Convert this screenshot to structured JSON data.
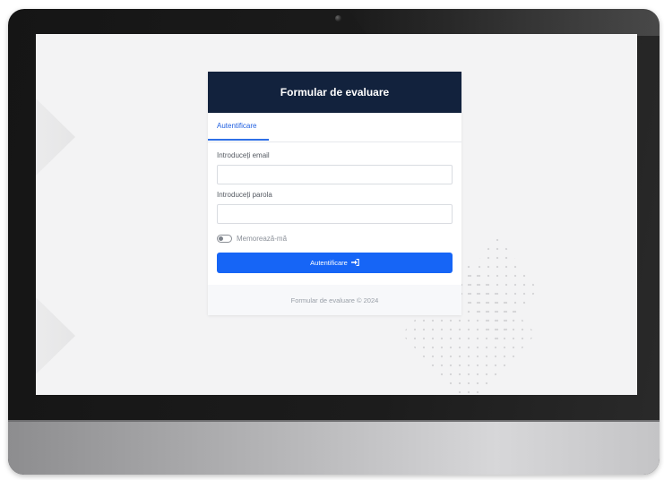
{
  "card": {
    "title": "Formular de evaluare"
  },
  "tabs": [
    {
      "label": "Autentificare",
      "active": true
    }
  ],
  "form": {
    "email_label": "Introduceți email",
    "email_value": "",
    "email_placeholder": "",
    "password_label": "Introduceți parola",
    "password_value": "",
    "password_placeholder": "",
    "remember_label": "Memorează-mă",
    "remember_checked": false,
    "submit_label": "Autentificare",
    "submit_icon": "sign-in-icon"
  },
  "footer": {
    "text": "Formular de evaluare © 2024"
  },
  "colors": {
    "header_bg": "#12223d",
    "accent": "#1665f6",
    "screen_bg": "#f3f3f4"
  }
}
